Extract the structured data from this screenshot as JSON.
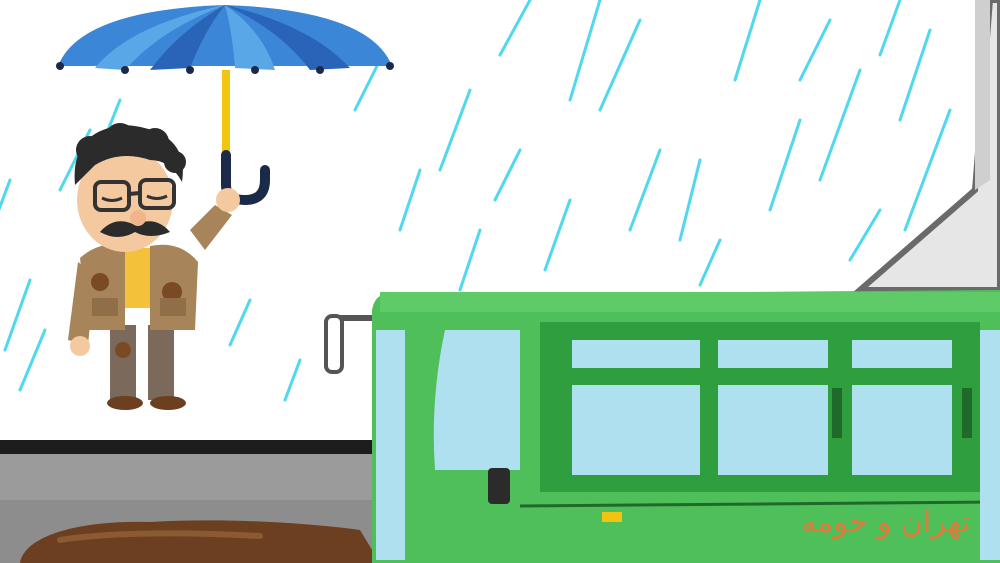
{
  "scene": {
    "bus": {
      "caption": "تهران و حومه",
      "body_color": "#4fbf5a",
      "window_color": "#aee0f0",
      "caption_color": "#e07a3a"
    },
    "umbrella": {
      "canopy_color": "#3b86d6",
      "handle_color": "#1c2a4a"
    },
    "rain_color": "#4fd8ee",
    "puddle_color": "#6b3f1f",
    "character": {
      "coat_color": "#a8845a",
      "mud_color": "#7a4a24"
    }
  }
}
